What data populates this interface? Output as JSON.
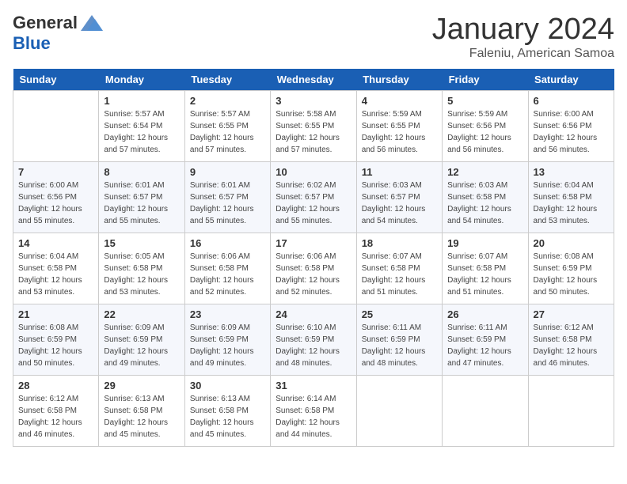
{
  "logo": {
    "general": "General",
    "blue": "Blue"
  },
  "header": {
    "title": "January 2024",
    "subtitle": "Faleniu, American Samoa"
  },
  "days_of_week": [
    "Sunday",
    "Monday",
    "Tuesday",
    "Wednesday",
    "Thursday",
    "Friday",
    "Saturday"
  ],
  "weeks": [
    [
      {
        "day": "",
        "info": ""
      },
      {
        "day": "1",
        "info": "Sunrise: 5:57 AM\nSunset: 6:54 PM\nDaylight: 12 hours\nand 57 minutes."
      },
      {
        "day": "2",
        "info": "Sunrise: 5:57 AM\nSunset: 6:55 PM\nDaylight: 12 hours\nand 57 minutes."
      },
      {
        "day": "3",
        "info": "Sunrise: 5:58 AM\nSunset: 6:55 PM\nDaylight: 12 hours\nand 57 minutes."
      },
      {
        "day": "4",
        "info": "Sunrise: 5:59 AM\nSunset: 6:55 PM\nDaylight: 12 hours\nand 56 minutes."
      },
      {
        "day": "5",
        "info": "Sunrise: 5:59 AM\nSunset: 6:56 PM\nDaylight: 12 hours\nand 56 minutes."
      },
      {
        "day": "6",
        "info": "Sunrise: 6:00 AM\nSunset: 6:56 PM\nDaylight: 12 hours\nand 56 minutes."
      }
    ],
    [
      {
        "day": "7",
        "info": "Sunrise: 6:00 AM\nSunset: 6:56 PM\nDaylight: 12 hours\nand 55 minutes."
      },
      {
        "day": "8",
        "info": "Sunrise: 6:01 AM\nSunset: 6:57 PM\nDaylight: 12 hours\nand 55 minutes."
      },
      {
        "day": "9",
        "info": "Sunrise: 6:01 AM\nSunset: 6:57 PM\nDaylight: 12 hours\nand 55 minutes."
      },
      {
        "day": "10",
        "info": "Sunrise: 6:02 AM\nSunset: 6:57 PM\nDaylight: 12 hours\nand 55 minutes."
      },
      {
        "day": "11",
        "info": "Sunrise: 6:03 AM\nSunset: 6:57 PM\nDaylight: 12 hours\nand 54 minutes."
      },
      {
        "day": "12",
        "info": "Sunrise: 6:03 AM\nSunset: 6:58 PM\nDaylight: 12 hours\nand 54 minutes."
      },
      {
        "day": "13",
        "info": "Sunrise: 6:04 AM\nSunset: 6:58 PM\nDaylight: 12 hours\nand 53 minutes."
      }
    ],
    [
      {
        "day": "14",
        "info": "Sunrise: 6:04 AM\nSunset: 6:58 PM\nDaylight: 12 hours\nand 53 minutes."
      },
      {
        "day": "15",
        "info": "Sunrise: 6:05 AM\nSunset: 6:58 PM\nDaylight: 12 hours\nand 53 minutes."
      },
      {
        "day": "16",
        "info": "Sunrise: 6:06 AM\nSunset: 6:58 PM\nDaylight: 12 hours\nand 52 minutes."
      },
      {
        "day": "17",
        "info": "Sunrise: 6:06 AM\nSunset: 6:58 PM\nDaylight: 12 hours\nand 52 minutes."
      },
      {
        "day": "18",
        "info": "Sunrise: 6:07 AM\nSunset: 6:58 PM\nDaylight: 12 hours\nand 51 minutes."
      },
      {
        "day": "19",
        "info": "Sunrise: 6:07 AM\nSunset: 6:58 PM\nDaylight: 12 hours\nand 51 minutes."
      },
      {
        "day": "20",
        "info": "Sunrise: 6:08 AM\nSunset: 6:59 PM\nDaylight: 12 hours\nand 50 minutes."
      }
    ],
    [
      {
        "day": "21",
        "info": "Sunrise: 6:08 AM\nSunset: 6:59 PM\nDaylight: 12 hours\nand 50 minutes."
      },
      {
        "day": "22",
        "info": "Sunrise: 6:09 AM\nSunset: 6:59 PM\nDaylight: 12 hours\nand 49 minutes."
      },
      {
        "day": "23",
        "info": "Sunrise: 6:09 AM\nSunset: 6:59 PM\nDaylight: 12 hours\nand 49 minutes."
      },
      {
        "day": "24",
        "info": "Sunrise: 6:10 AM\nSunset: 6:59 PM\nDaylight: 12 hours\nand 48 minutes."
      },
      {
        "day": "25",
        "info": "Sunrise: 6:11 AM\nSunset: 6:59 PM\nDaylight: 12 hours\nand 48 minutes."
      },
      {
        "day": "26",
        "info": "Sunrise: 6:11 AM\nSunset: 6:59 PM\nDaylight: 12 hours\nand 47 minutes."
      },
      {
        "day": "27",
        "info": "Sunrise: 6:12 AM\nSunset: 6:58 PM\nDaylight: 12 hours\nand 46 minutes."
      }
    ],
    [
      {
        "day": "28",
        "info": "Sunrise: 6:12 AM\nSunset: 6:58 PM\nDaylight: 12 hours\nand 46 minutes."
      },
      {
        "day": "29",
        "info": "Sunrise: 6:13 AM\nSunset: 6:58 PM\nDaylight: 12 hours\nand 45 minutes."
      },
      {
        "day": "30",
        "info": "Sunrise: 6:13 AM\nSunset: 6:58 PM\nDaylight: 12 hours\nand 45 minutes."
      },
      {
        "day": "31",
        "info": "Sunrise: 6:14 AM\nSunset: 6:58 PM\nDaylight: 12 hours\nand 44 minutes."
      },
      {
        "day": "",
        "info": ""
      },
      {
        "day": "",
        "info": ""
      },
      {
        "day": "",
        "info": ""
      }
    ]
  ]
}
